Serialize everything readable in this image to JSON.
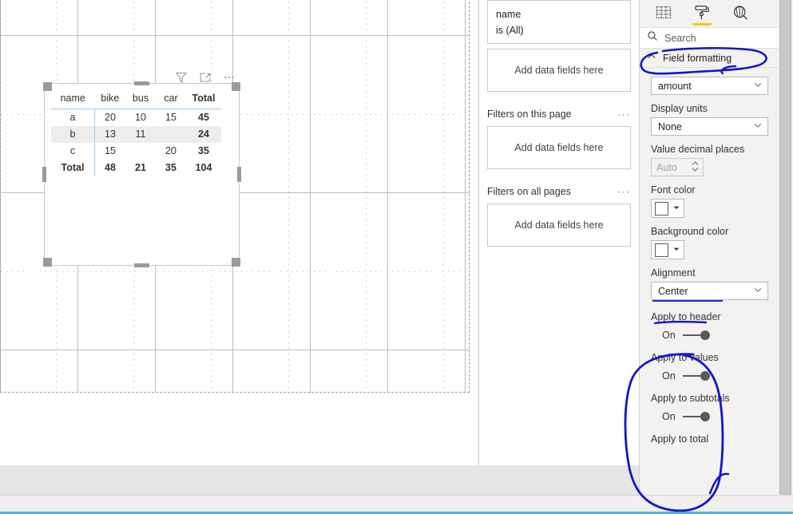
{
  "app": {
    "product": "Power BI Desktop report canvas"
  },
  "visual_header": {
    "filter_icon": "filter-funnel-icon",
    "focus_icon": "focus-mode-icon",
    "more_icon": "more-options-icon"
  },
  "matrix": {
    "columns": [
      "name",
      "bike",
      "bus",
      "car",
      "Total"
    ],
    "rows": [
      {
        "name": "a",
        "bike": "20",
        "bus": "10",
        "car": "15",
        "total": "45",
        "banded": false
      },
      {
        "name": "b",
        "bike": "13",
        "bus": "11",
        "car": "",
        "total": "24",
        "banded": true
      },
      {
        "name": "c",
        "bike": "15",
        "bus": "",
        "car": "20",
        "total": "35",
        "banded": false
      }
    ],
    "total_row": {
      "name": "Total",
      "bike": "48",
      "bus": "21",
      "car": "35",
      "total": "104"
    }
  },
  "filters": {
    "applied_filter": {
      "field": "name",
      "state": "is (All)"
    },
    "visual_dropzone": "Add data fields here",
    "page_section": {
      "title": "Filters on this page",
      "menu": "···",
      "dropzone": "Add data fields here"
    },
    "all_pages_section": {
      "title": "Filters on all pages",
      "menu": "···",
      "dropzone": "Add data fields here"
    }
  },
  "format_pane": {
    "tabs": [
      {
        "name": "build-visual-tab",
        "icon": "fields-table-icon",
        "selected": false
      },
      {
        "name": "format-tab",
        "icon": "paint-roller-icon",
        "selected": true
      },
      {
        "name": "analytics-tab",
        "icon": "analytics-magnifier-icon",
        "selected": false
      }
    ],
    "search_placeholder": "Search",
    "search_icon": "search-icon",
    "section": {
      "title": "Field formatting",
      "expanded_icon": "chevron-up-icon"
    },
    "field_select": {
      "label": "",
      "value": "amount"
    },
    "display_units": {
      "label": "Display units",
      "value": "None"
    },
    "value_decimal_places": {
      "label": "Value decimal places",
      "value": "Auto"
    },
    "font_color": {
      "label": "Font color",
      "swatch": "#ffffff"
    },
    "background_color": {
      "label": "Background color",
      "swatch": "#ffffff"
    },
    "alignment": {
      "label": "Alignment",
      "value": "Center"
    },
    "apply_to_header": {
      "label": "Apply to header",
      "state": "On"
    },
    "apply_to_values": {
      "label": "Apply to values",
      "state": "On"
    },
    "apply_to_subtotals": {
      "label": "Apply to subtotals",
      "state": "On"
    },
    "apply_to_total": {
      "label": "Apply to total"
    }
  },
  "annotations": {
    "color": "#1414cd",
    "marks": [
      {
        "name": "field-formatting-circle",
        "shape": "hand-drawn-ellipse"
      },
      {
        "name": "alignment-underline",
        "shape": "hand-drawn-underline"
      },
      {
        "name": "apply-to-toggles-circle",
        "shape": "hand-drawn-ellipse"
      }
    ]
  }
}
